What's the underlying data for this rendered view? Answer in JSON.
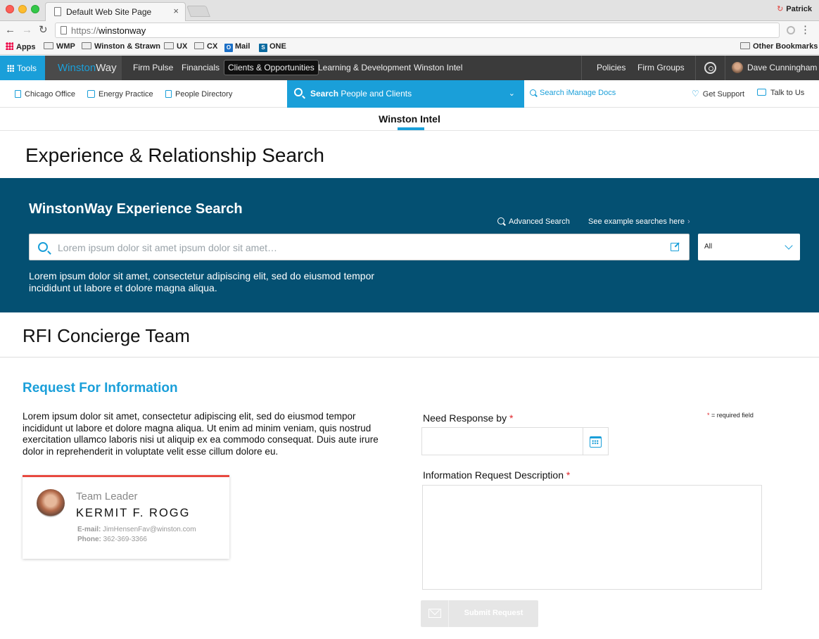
{
  "browser": {
    "tab_title": "Default Web Site Page",
    "tab_close": "×",
    "profile_name": "Patrick",
    "url_scheme": "https://",
    "url_host": "winstonway",
    "menu": "⋮",
    "bookmarks": [
      "Apps",
      "WMP",
      "Winston & Strawn",
      "UX",
      "CX",
      "Mail",
      "ONE"
    ],
    "other_bookmarks": "Other Bookmarks"
  },
  "sitenav": {
    "tools_label": "Tools",
    "brand_part1": "Winston",
    "brand_part2": "Way",
    "links": [
      "Firm Pulse",
      "Financials",
      "Clients & Opportunities",
      "Learning & Development",
      "Winston Intel"
    ],
    "active_link": "Clients & Opportunities",
    "right_links": [
      "Policies",
      "Firm Groups"
    ],
    "user_name": "Dave Cunningham"
  },
  "subnav": {
    "links": [
      "Chicago Office",
      "Energy Practice",
      "People Directory"
    ],
    "search_bold": "Search",
    "search_rest": "People and Clients",
    "caret": "⌄",
    "imanage": "Search iManage Docs",
    "support": "Get Support",
    "talk": "Talk to Us"
  },
  "section_tab": "Winston Intel",
  "page_title": "Experience & Relationship Search",
  "experience": {
    "title": "WinstonWay Experience Search",
    "advanced": "Advanced Search",
    "examples": "See example searches here",
    "examples_chevron": "›",
    "placeholder": "Lorem ipsum dolor sit amet ipsum dolor sit amet…",
    "select_value": "All",
    "description": "Lorem ipsum dolor sit amet, consectetur adipiscing elit, sed do eiusmod tempor incididunt ut labore et dolore magna aliqua."
  },
  "rfi": {
    "section_title": "RFI Concierge Team",
    "title": "Request For Information",
    "body": "Lorem ipsum dolor sit amet, consectetur adipiscing elit, sed do eiusmod tempor incididunt ut labore et dolore magna aliqua. Ut enim ad minim veniam, quis nostrud exercitation ullamco laboris nisi ut aliquip ex ea commodo consequat. Duis aute irure dolor in reprehenderit in voluptate velit esse cillum dolore eu.",
    "leader_role": "Team Leader",
    "leader_name": "KERMIT F. ROGG",
    "email_label": "E-mail:",
    "email_value": "JimHensenFav@winston.com",
    "phone_label": "Phone:",
    "phone_value": "362-369-3366",
    "required_star": "*",
    "required_note": "= required field",
    "need_label": "Need Response by",
    "desc_label": "Information Request Description",
    "submit": "Submit Request"
  },
  "colors": {
    "accent": "#1a9fd9",
    "panel": "#045072",
    "nav_dark": "#3b3b3b",
    "required": "#e0262b",
    "card_top": "#e8483f"
  }
}
